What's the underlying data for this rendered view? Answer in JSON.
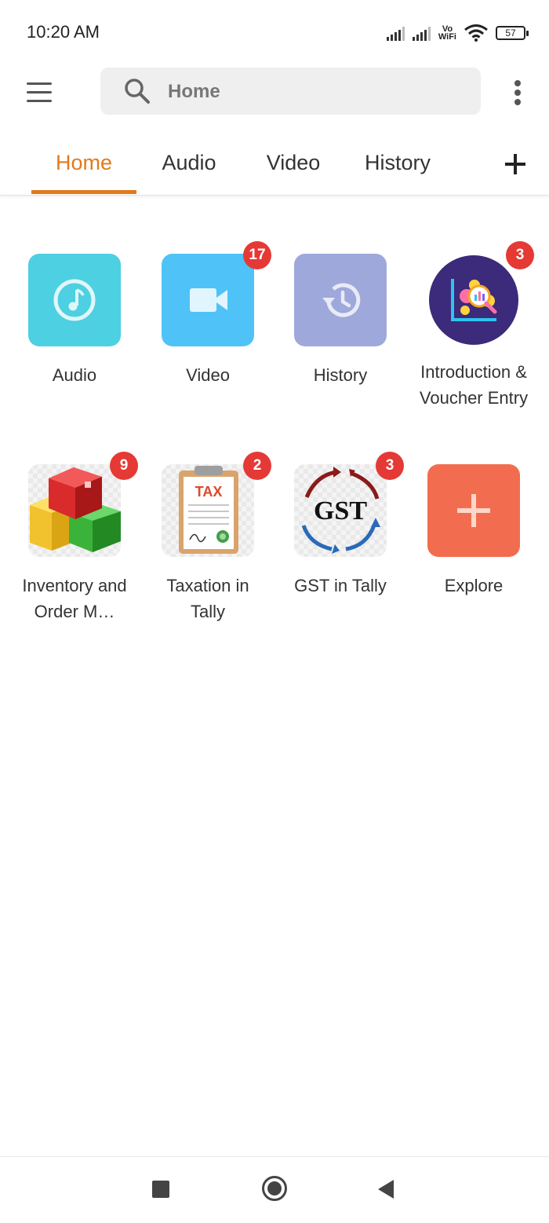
{
  "status_bar": {
    "time": "10:20 AM",
    "vowifi_top": "Vo",
    "vowifi_bottom": "WiFi",
    "battery": "57"
  },
  "app_bar": {
    "search_placeholder": "Home"
  },
  "tabs": [
    {
      "label": "Home",
      "active": true
    },
    {
      "label": "Audio",
      "active": false
    },
    {
      "label": "Video",
      "active": false
    },
    {
      "label": "History",
      "active": false
    }
  ],
  "grid": [
    {
      "label": "Audio",
      "badge": null,
      "color": "#4dd0e1",
      "icon": "music-note-icon"
    },
    {
      "label": "Video",
      "badge": "17",
      "color": "#4fc3f7",
      "icon": "video-camera-icon"
    },
    {
      "label": "History",
      "badge": null,
      "color": "#9fa8da",
      "icon": "history-clock-icon"
    },
    {
      "label": "Introduction & Voucher Entry",
      "badge": "3",
      "color": "#3c2a7a",
      "icon": "analytics-chart-icon"
    },
    {
      "label": "Inventory and Order M…",
      "badge": "9",
      "icon": "stacked-boxes-icon"
    },
    {
      "label": "Taxation in Tally",
      "badge": "2",
      "icon": "tax-clipboard-icon",
      "icon_text": "TAX"
    },
    {
      "label": "GST in Tally",
      "badge": "3",
      "icon": "gst-cycle-icon",
      "icon_text": "GST"
    },
    {
      "label": "Explore",
      "badge": null,
      "color": "#f26d4f",
      "icon": "plus-icon"
    }
  ],
  "colors": {
    "accent": "#e07a1c",
    "badge": "#e53935"
  }
}
